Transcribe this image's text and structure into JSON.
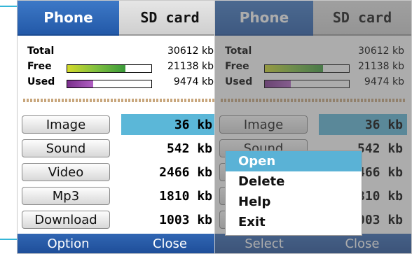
{
  "tabs": {
    "phone": "Phone",
    "sdcard": "SD card"
  },
  "stats": {
    "total_label": "Total",
    "total_value": "30612 kb",
    "free_label": "Free",
    "free_value": "21138 kb",
    "free_fraction": 0.69,
    "used_label": "Used",
    "used_value": "9474 kb",
    "used_fraction": 0.31
  },
  "categories": [
    {
      "name": "Image",
      "size": "36 kb"
    },
    {
      "name": "Sound",
      "size": "542 kb"
    },
    {
      "name": "Video",
      "size": "2466 kb"
    },
    {
      "name": "Mp3",
      "size": "1810 kb"
    },
    {
      "name": "Download",
      "size": "1003 kb"
    }
  ],
  "left_softkeys": {
    "left": "Option",
    "right": "Close"
  },
  "right_softkeys": {
    "left": "Select",
    "right": "Close"
  },
  "menu": [
    "Open",
    "Delete",
    "Help",
    "Exit"
  ],
  "colors": {
    "accent_blue": "#2a5fb0",
    "selected_cyan": "#5bb7d8",
    "free_bar": "#7fbf3f",
    "used_bar": "#8e3aa1"
  }
}
